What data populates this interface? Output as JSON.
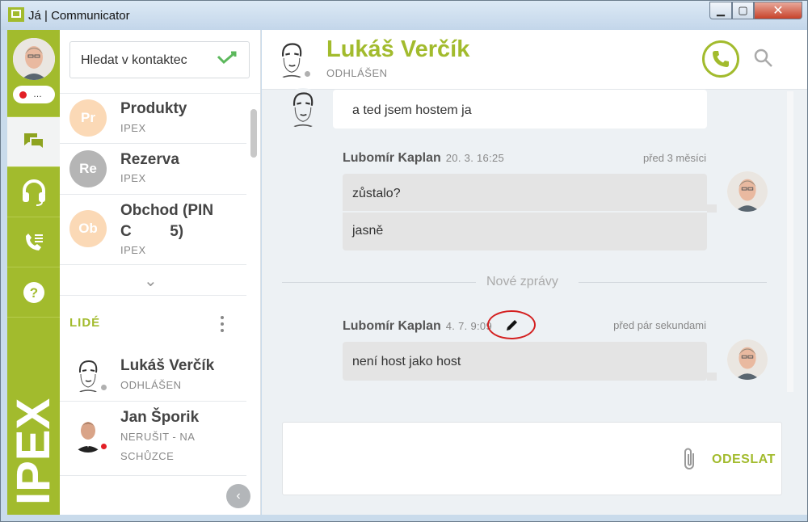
{
  "window": {
    "title": "Já | Communicator",
    "close_glyph": "✕",
    "min_glyph": "▁",
    "max_glyph": "▢"
  },
  "rail": {
    "status_text": "…",
    "logo_text": "IPEX",
    "help_glyph": "?"
  },
  "contacts": {
    "search_placeholder": "Hledat v kontaktec",
    "groups": [
      {
        "initials": "Pr",
        "name": "Produkty",
        "sub": "IPEX",
        "color": "#fbd9b6"
      },
      {
        "initials": "Re",
        "name": "Rezerva",
        "sub": "IPEX",
        "color": "#b5b5b5"
      },
      {
        "initials": "Ob",
        "name_line1": "Obchod (PIN",
        "name_line2": "C     5)",
        "sub": "IPEX",
        "color": "#fbd9b6"
      }
    ],
    "expand_glyph": "⌄",
    "people_label": "LIDÉ",
    "people": [
      {
        "name": "Lukáš Verčík",
        "status": "ODHLÁŠEN",
        "presence": "#b0b0b0"
      },
      {
        "name": "Jan Šporik",
        "status_line1": "NERUŠIT - NA",
        "status_line2": "SCHŮZCE",
        "presence": "#e21f26"
      }
    ],
    "collapse_glyph": "‹"
  },
  "chat": {
    "contact_name": "Lukáš Verčík",
    "contact_status": "ODHLÁŠEN",
    "messages": [
      {
        "text": "a ted jsem hostem ja"
      }
    ],
    "group1": {
      "author": "Lubomír Kaplan",
      "date": "20. 3. 16:25",
      "ago": "před 3 měsíci",
      "lines": [
        "zůstalo?",
        "jasně"
      ]
    },
    "separator": "Nové zprávy",
    "group2": {
      "author": "Lubomír Kaplan",
      "date": "4. 7. 9:09",
      "ago": "před pár sekundami",
      "lines": [
        "není host jako host"
      ]
    },
    "send_label": "ODESLAT"
  },
  "colors": {
    "brand": "#a2bb2d",
    "status_red": "#e21f26"
  }
}
